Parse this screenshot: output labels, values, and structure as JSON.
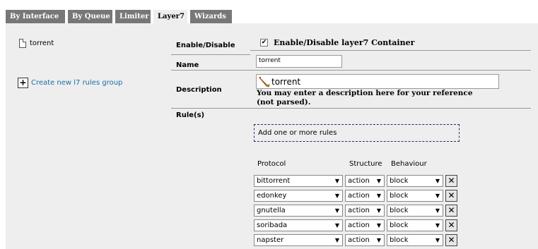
{
  "tabs": [
    "By Interface",
    "By Queue",
    "Limiter",
    "Layer7",
    "Wizards"
  ],
  "active_tab": "Layer7",
  "sidebar": {
    "item": "torrent",
    "create_link": "Create new l7 rules group"
  },
  "form": {
    "enable_label": "Enable/Disable",
    "enable_text": "Enable/Disable layer7 Container",
    "enable_checked": true,
    "name_label": "Name",
    "name_value": "torrent",
    "desc_label": "Description",
    "desc_value": "torrent",
    "desc_help": "You may enter a description here for your reference (not parsed).",
    "rules_label": "Rule(s)",
    "add_rules": "Add one or more rules"
  },
  "rules": {
    "headers": {
      "protocol": "Protocol",
      "structure": "Structure",
      "behaviour": "Behaviour"
    },
    "rows": [
      {
        "protocol": "bittorrent",
        "structure": "action",
        "behaviour": "block"
      },
      {
        "protocol": "edonkey",
        "structure": "action",
        "behaviour": "block"
      },
      {
        "protocol": "gnutella",
        "structure": "action",
        "behaviour": "block"
      },
      {
        "protocol": "soribada",
        "structure": "action",
        "behaviour": "block"
      },
      {
        "protocol": "napster",
        "structure": "action",
        "behaviour": "block"
      }
    ]
  },
  "colors": {
    "tab": "#777777",
    "panel": "#eeeeee",
    "link": "#1a6fa8"
  }
}
